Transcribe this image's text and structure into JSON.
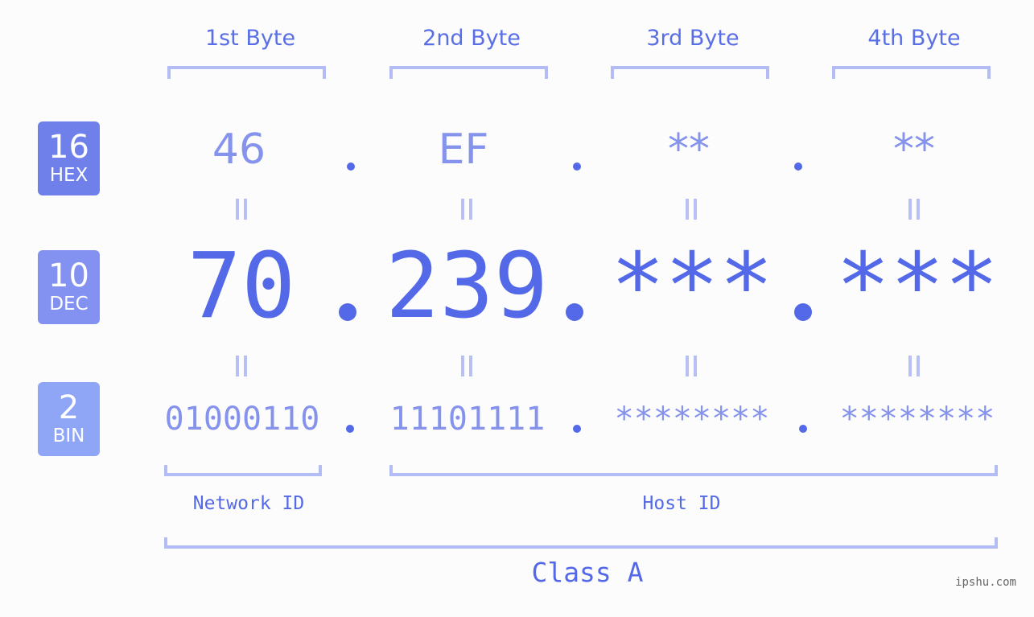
{
  "bytes": {
    "headers": [
      "1st Byte",
      "2nd Byte",
      "3rd Byte",
      "4th Byte"
    ]
  },
  "bases": {
    "hex": {
      "num": "16",
      "label": "HEX"
    },
    "dec": {
      "num": "10",
      "label": "DEC"
    },
    "bin": {
      "num": "2",
      "label": "BIN"
    }
  },
  "ip": {
    "hex": [
      "46",
      "EF",
      "**",
      "**"
    ],
    "dec": [
      "70",
      "239",
      "***",
      "***"
    ],
    "bin": [
      "01000110",
      "11101111",
      "********",
      "********"
    ]
  },
  "segments": {
    "network_id": "Network ID",
    "host_id": "Host ID",
    "class": "Class A"
  },
  "watermark": "ipshu.com",
  "colors": {
    "accent": "#5469e8",
    "light_accent": "#8593ec",
    "bracket": "#b3bcf5",
    "hex_badge": "#6f80ea",
    "dec_badge": "#8392f0",
    "bin_badge": "#8fa6f7"
  }
}
